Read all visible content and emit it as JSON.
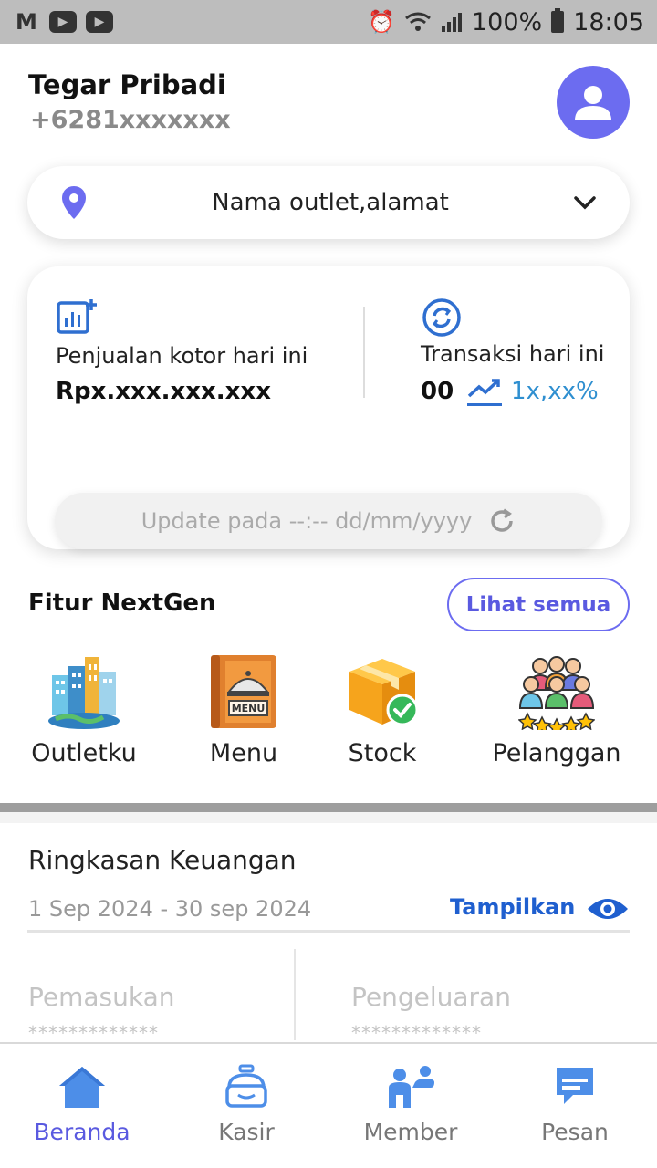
{
  "status_bar": {
    "battery": "100%",
    "time": "18:05"
  },
  "header": {
    "name": "Tegar Pribadi",
    "phone": "+6281xxxxxxx"
  },
  "outlet_selector": {
    "label": "Nama outlet,alamat"
  },
  "summary_card": {
    "sales_label": "Penjualan kotor hari ini",
    "sales_value": "Rpx.xxx.xxx.xxx",
    "transactions_label": "Transaksi hari ini",
    "transactions_count": "00",
    "transactions_growth": "1x,xx%",
    "update_text": "Update pada --:-- dd/mm/yyyy"
  },
  "features": {
    "title": "Fitur NextGen",
    "see_all": "Lihat semua",
    "items": [
      {
        "label": "Outletku",
        "icon": "city-buildings-icon"
      },
      {
        "label": "Menu",
        "icon": "menu-book-icon"
      },
      {
        "label": "Stock",
        "icon": "stock-box-icon"
      },
      {
        "label": "Pelanggan",
        "icon": "customers-icon"
      }
    ]
  },
  "finance": {
    "title": "Ringkasan Keuangan",
    "period": "1 Sep 2024 - 30 sep 2024",
    "show_label": "Tampilkan",
    "income_label": "Pemasukan",
    "income_value": "*************",
    "expense_label": "Pengeluaran",
    "expense_value": "*************"
  },
  "bottom_nav": [
    {
      "label": "Beranda",
      "icon": "home-icon",
      "active": true
    },
    {
      "label": "Kasir",
      "icon": "cashier-icon",
      "active": false
    },
    {
      "label": "Member",
      "icon": "member-icon",
      "active": false
    },
    {
      "label": "Pesan",
      "icon": "message-icon",
      "active": false
    }
  ],
  "colors": {
    "accent": "#6c6cf0",
    "link_blue": "#1f5fcf",
    "growth_blue": "#2f8fd0",
    "status_bar": "#bdbdbd"
  }
}
